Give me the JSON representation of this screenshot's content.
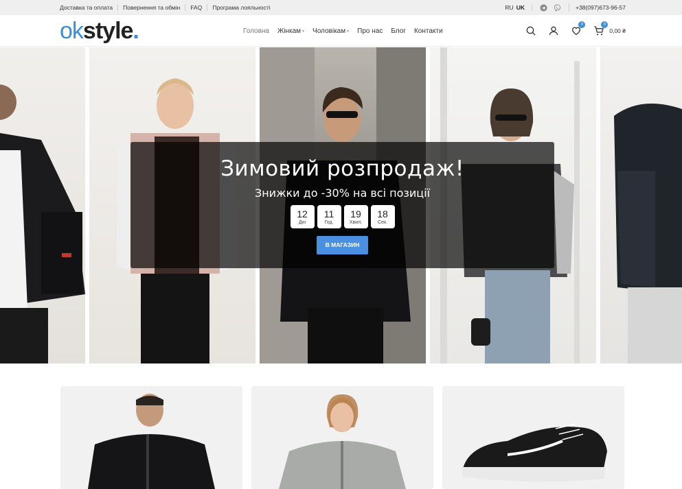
{
  "topbar": {
    "links": [
      "Доставка та оплата",
      "Повернення та обмін",
      "FAQ",
      "Програма лояльності"
    ],
    "lang": {
      "ru": "RU",
      "uk": "UK"
    },
    "social": {
      "telegram_icon": "telegram-icon",
      "viber_icon": "viber-icon"
    },
    "phone": "+38(097)673-96-57"
  },
  "header": {
    "logo": {
      "part1": "ok",
      "part2": "style",
      "dot": "."
    },
    "nav": [
      {
        "label": "Головна",
        "dropdown": false
      },
      {
        "label": "Жінкам",
        "dropdown": true
      },
      {
        "label": "Чоловікам",
        "dropdown": true
      },
      {
        "label": "Про нас",
        "dropdown": false
      },
      {
        "label": "Блог",
        "dropdown": false
      },
      {
        "label": "Контакти",
        "dropdown": false
      }
    ],
    "wishlist_count": "0",
    "cart_count": "0",
    "cart_total": "0,00 ₴"
  },
  "hero": {
    "title": "Зимовий розпродаж!",
    "subtitle": "Знижки до -30% на всі позиції",
    "countdown": [
      {
        "value": "12",
        "label": "Дні"
      },
      {
        "value": "11",
        "label": "Год."
      },
      {
        "value": "19",
        "label": "Хвил."
      },
      {
        "value": "18",
        "label": "Сек."
      }
    ],
    "button": "В МАГАЗИН"
  },
  "colors": {
    "accent": "#3b8ed8",
    "button": "#4a90e2",
    "topbar_bg": "#efefef"
  }
}
